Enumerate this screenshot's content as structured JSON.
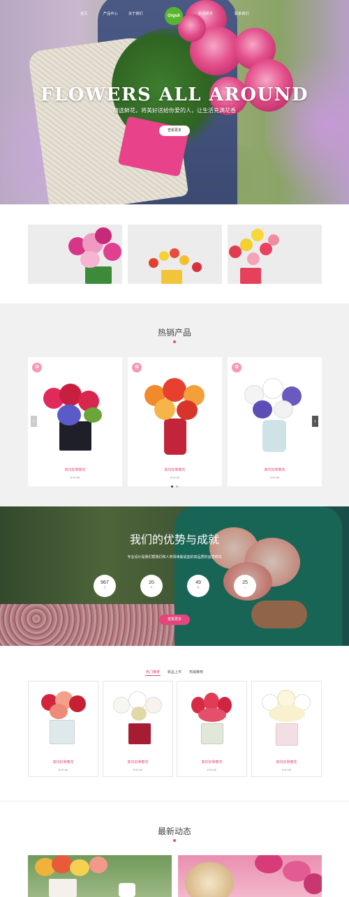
{
  "nav": {
    "items": [
      "首页",
      "产品中心",
      "关于我们",
      "新闻资讯",
      "联系我们"
    ],
    "logo": "Orguli"
  },
  "hero": {
    "title": "FLOWERS ALL AROUND",
    "subtitle": "精选鲜花，将美好送给你爱的人，让生活充满花香",
    "button": "查看更多"
  },
  "hot_products": {
    "title": "热销产品",
    "items": [
      {
        "name": "高均好渺泰花",
        "price": "¥ 00.00"
      },
      {
        "name": "高均好渺泰花",
        "price": "¥ 00.00"
      },
      {
        "name": "高均好渺泰花",
        "price": "¥ 00.00"
      }
    ],
    "prev": "‹",
    "next": "›"
  },
  "advantages": {
    "title": "我们的优势与成就",
    "subtitle": "专业设计是我们帮我们和人类阅读最适宜的高品质的运营鲜花",
    "stats": [
      {
        "value": "967",
        "label": "花"
      },
      {
        "value": "20",
        "label": "年"
      },
      {
        "value": "49",
        "label": "种"
      },
      {
        "value": "25",
        "label": "人"
      }
    ],
    "button": "查看更多"
  },
  "tabs": {
    "items": [
      "热门推荐",
      "新品上市",
      "热销推荐"
    ],
    "products": [
      {
        "name": "高均好渺泰花",
        "price": "¥ 00.00"
      },
      {
        "name": "高均好渺泰花",
        "price": "¥ 00.00"
      },
      {
        "name": "高均好渺泰花",
        "price": "¥ 00.00"
      },
      {
        "name": "高均好渺泰花",
        "price": "¥ 00.00"
      }
    ]
  },
  "news": {
    "title": "最新动态"
  },
  "colors": {
    "accent": "#e5457d",
    "logo_green": "#58b52e",
    "section_gray": "#f1f1f1"
  }
}
